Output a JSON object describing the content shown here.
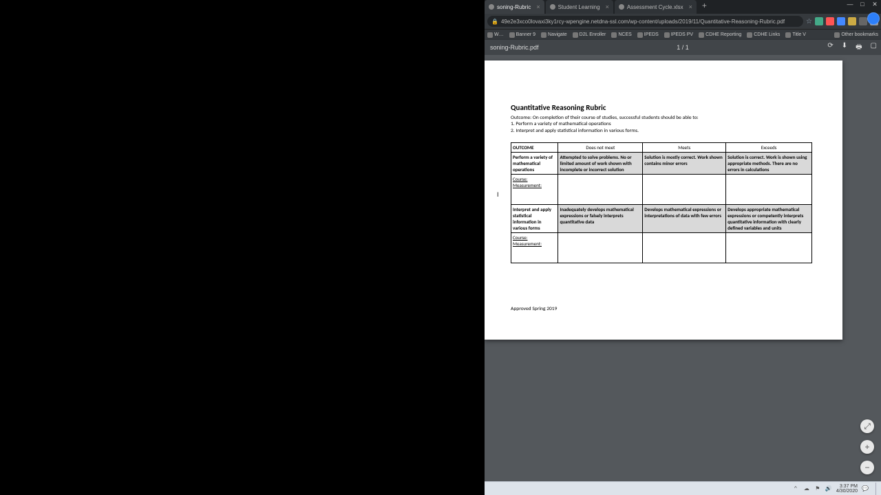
{
  "window": {
    "tabs": [
      {
        "title": "soning-Rubric",
        "active": true
      },
      {
        "title": "Student Learning",
        "active": false
      },
      {
        "title": "Assessment Cycle.xlsx",
        "active": false
      }
    ],
    "minimize": "—",
    "maximize": "□",
    "close": "✕"
  },
  "address": {
    "lock": "🔒",
    "url": "49e2e3xco0lovaxi3ky1rcy-wpengine.netdna-ssl.com/wp-content/uploads/2019/11/Quantitative-Reasoning-Rubric.pdf",
    "star": "☆"
  },
  "bookmarks": {
    "items": [
      "W…",
      "Banner 9",
      "Navigate",
      "D2L Enroller",
      "NCES",
      "IPEDS",
      "IPEDS PV",
      "CDHE Reporting",
      "CDHE Links",
      "Title V"
    ],
    "other": "Other bookmarks"
  },
  "pdf": {
    "filename": "soning-Rubric.pdf",
    "pageIndicator": "1 / 1",
    "reload": "⟳",
    "download": "⬇",
    "print": "🖶",
    "present": "▢"
  },
  "doc": {
    "title": "Quantitative Reasoning Rubric",
    "outcomeLine": "Outcome: On completion of their course of studies, successful students should be able to:",
    "bullet1": "1. Perform a variety of mathematical operations",
    "bullet2": "2. Interpret and apply statistical information in various forms.",
    "table": {
      "headOutcome": "OUTCOME",
      "headDoesNotMeet": "Does not meet",
      "headMeets": "Meets",
      "headExceeds": "Exceeds",
      "row1": {
        "outcome": "Perform a variety of mathematical operations",
        "dnm": "Attempted to solve problems. No or limited amount of work shown with incomplete or incorrect solution",
        "meets": "Solution is mostly correct. Work shown contains minor errors",
        "exceeds": "Solution is correct. Work is shown using appropriate methods. There are no errors in calculations"
      },
      "courseLabel": "Course:",
      "measurementLabel": "Measurement:",
      "row2": {
        "outcome": "Interpret and apply statistical information in various forms",
        "dnm": "Inadequately develops mathematical expressions or falsely interprets quantitative data",
        "meets": "Develops mathematical expressions or interpretations of data with few errors",
        "exceeds": "Develops appropriate mathematical expressions or competently interprets quantitative information with clearly defined variables and units"
      }
    },
    "approved": "Approved Spring 2019"
  },
  "zoom": {
    "fit": "⤢",
    "in": "+",
    "out": "−"
  },
  "taskbar": {
    "time": "3:37 PM",
    "date": "4/30/2020"
  }
}
